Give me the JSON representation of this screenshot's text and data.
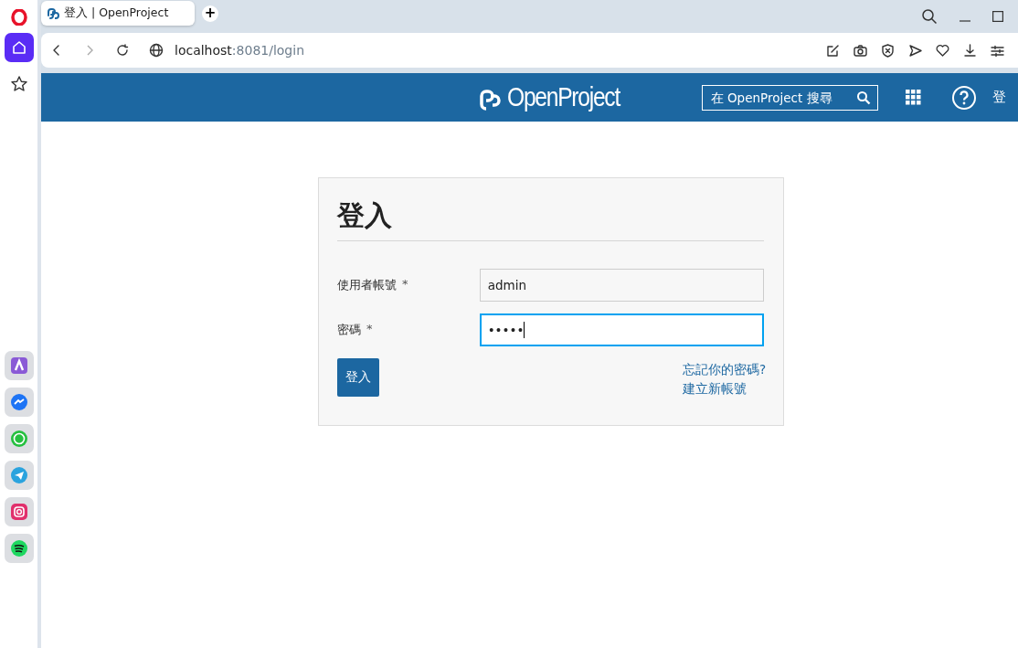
{
  "browser": {
    "sidebar": {
      "items": [
        {
          "kind": "home",
          "selected": true
        },
        {
          "kind": "star",
          "selected": false
        }
      ],
      "apps": [
        {
          "kind": "aria"
        },
        {
          "kind": "messenger"
        },
        {
          "kind": "whatsapp"
        },
        {
          "kind": "telegram"
        },
        {
          "kind": "instagram"
        },
        {
          "kind": "spotify"
        }
      ]
    },
    "tabs": [
      {
        "title": "登入 | OpenProject",
        "selected": true
      }
    ],
    "new_tab": "+",
    "address": {
      "host": "localhost",
      "path": ":8081/login"
    }
  },
  "header": {
    "logo": "OpenProject",
    "search": {
      "placeholder": "在 OpenProject 搜尋"
    },
    "sign_in": "登"
  },
  "login": {
    "title": "登入",
    "fields": [
      {
        "label": "使用者帳號",
        "required": "*",
        "value": "admin",
        "focused": false
      },
      {
        "label": "密碼",
        "required": "*",
        "value": "•••••",
        "focused": true
      }
    ],
    "submit": "登入",
    "links": [
      "忘記你的密碼?",
      "建立新帳號"
    ]
  }
}
